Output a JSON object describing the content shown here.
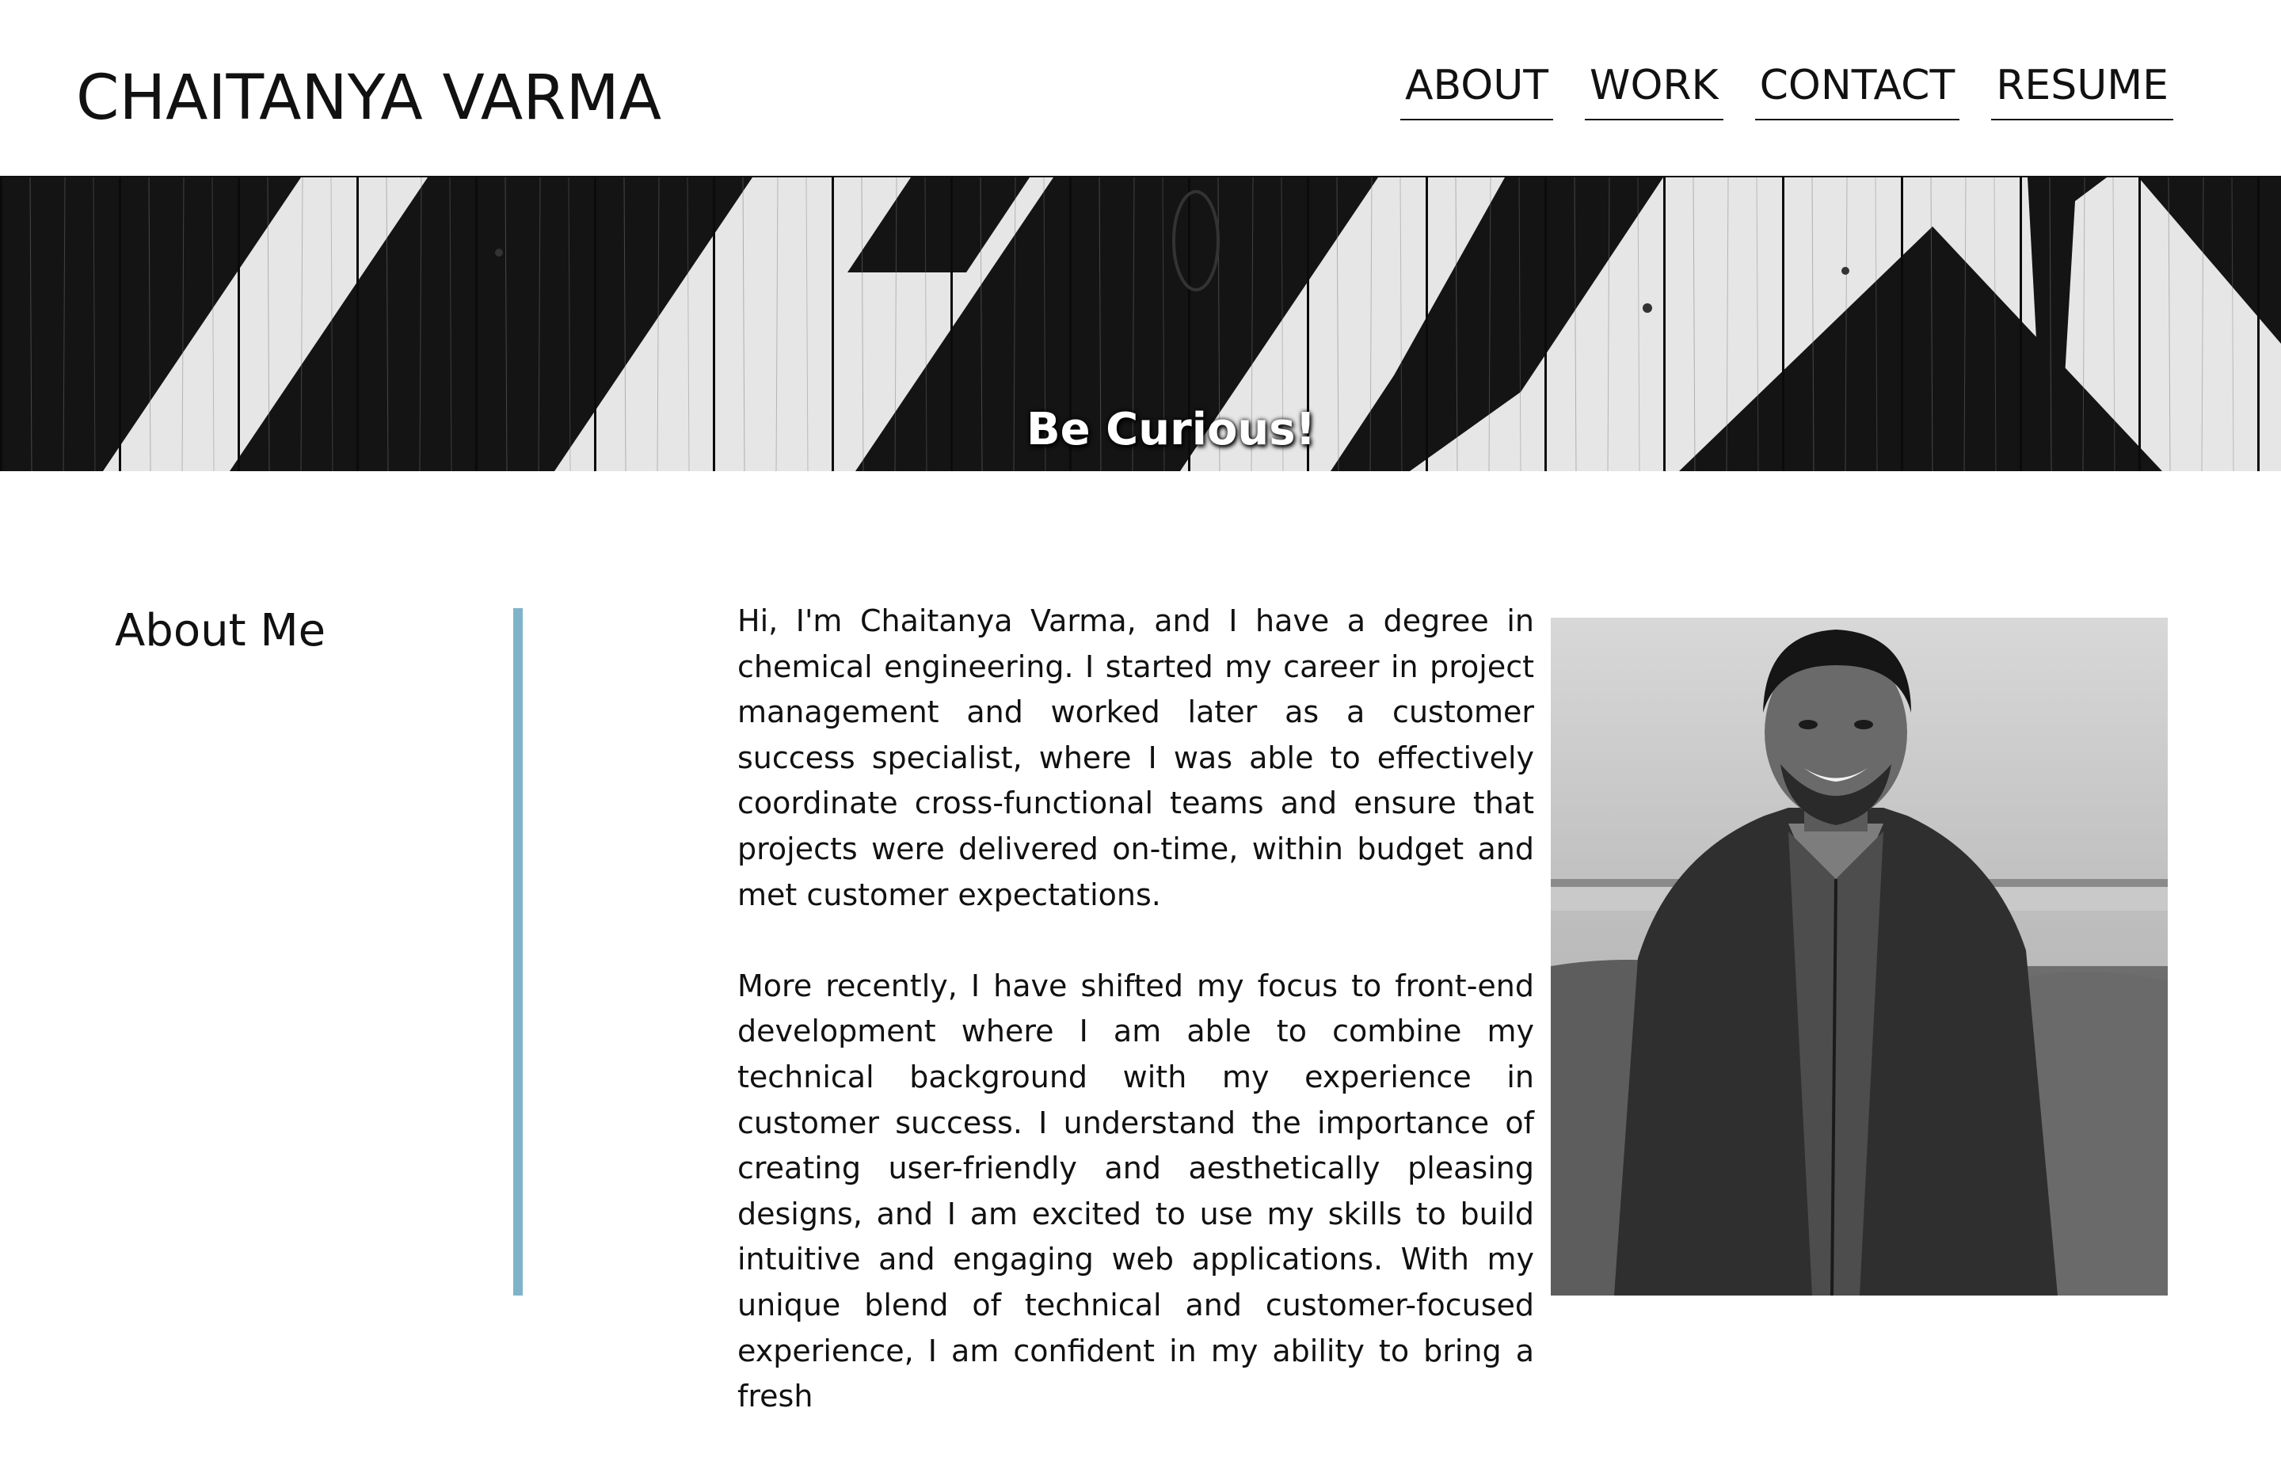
{
  "header": {
    "title": "CHAITANYA VARMA",
    "nav": [
      {
        "label": "ABOUT"
      },
      {
        "label": "WORK"
      },
      {
        "label": "CONTACT"
      },
      {
        "label": "RESUME"
      }
    ]
  },
  "hero": {
    "caption": "Be Curious!"
  },
  "about": {
    "heading": "About Me",
    "paragraphs": [
      "Hi, I'm Chaitanya Varma, and I have a degree in chemical engineering. I started my career in project management and worked later as a customer success specialist, where I was able to effectively coordinate cross-functional teams and ensure that projects were delivered on-time, within budget and met customer expectations.",
      "More recently, I have shifted my focus to front-end development where I am able to combine my technical background with my experience in customer success. I understand the importance of creating user-friendly and aesthetically pleasing designs, and I am excited to use my skills to build intuitive and engaging web applications. With my unique blend of technical and customer-focused experience, I am confident in my ability to bring a fresh"
    ],
    "accent_color": "#7fb3c8"
  }
}
